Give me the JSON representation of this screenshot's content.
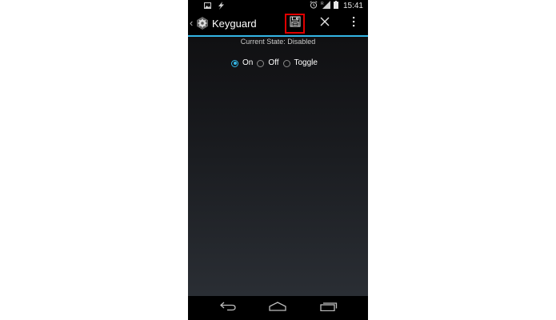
{
  "status_bar": {
    "left_icons": [
      "image-icon",
      "bolt-icon"
    ],
    "right_icons": [
      "alarm-icon",
      "signal-icon",
      "battery-icon"
    ],
    "time": "15:41"
  },
  "action_bar": {
    "title": "Keyguard",
    "actions": [
      "save-icon",
      "close-icon",
      "overflow-menu-icon"
    ],
    "accent_color": "#33b5e5",
    "highlight_color": "#e00000"
  },
  "content": {
    "current_state": "Current State: Disabled",
    "options": [
      {
        "label": "On",
        "checked": true
      },
      {
        "label": "Off",
        "checked": false
      },
      {
        "label": "Toggle",
        "checked": false
      }
    ]
  },
  "nav_bar": {
    "buttons": [
      "back-icon",
      "home-icon",
      "recents-icon"
    ]
  }
}
